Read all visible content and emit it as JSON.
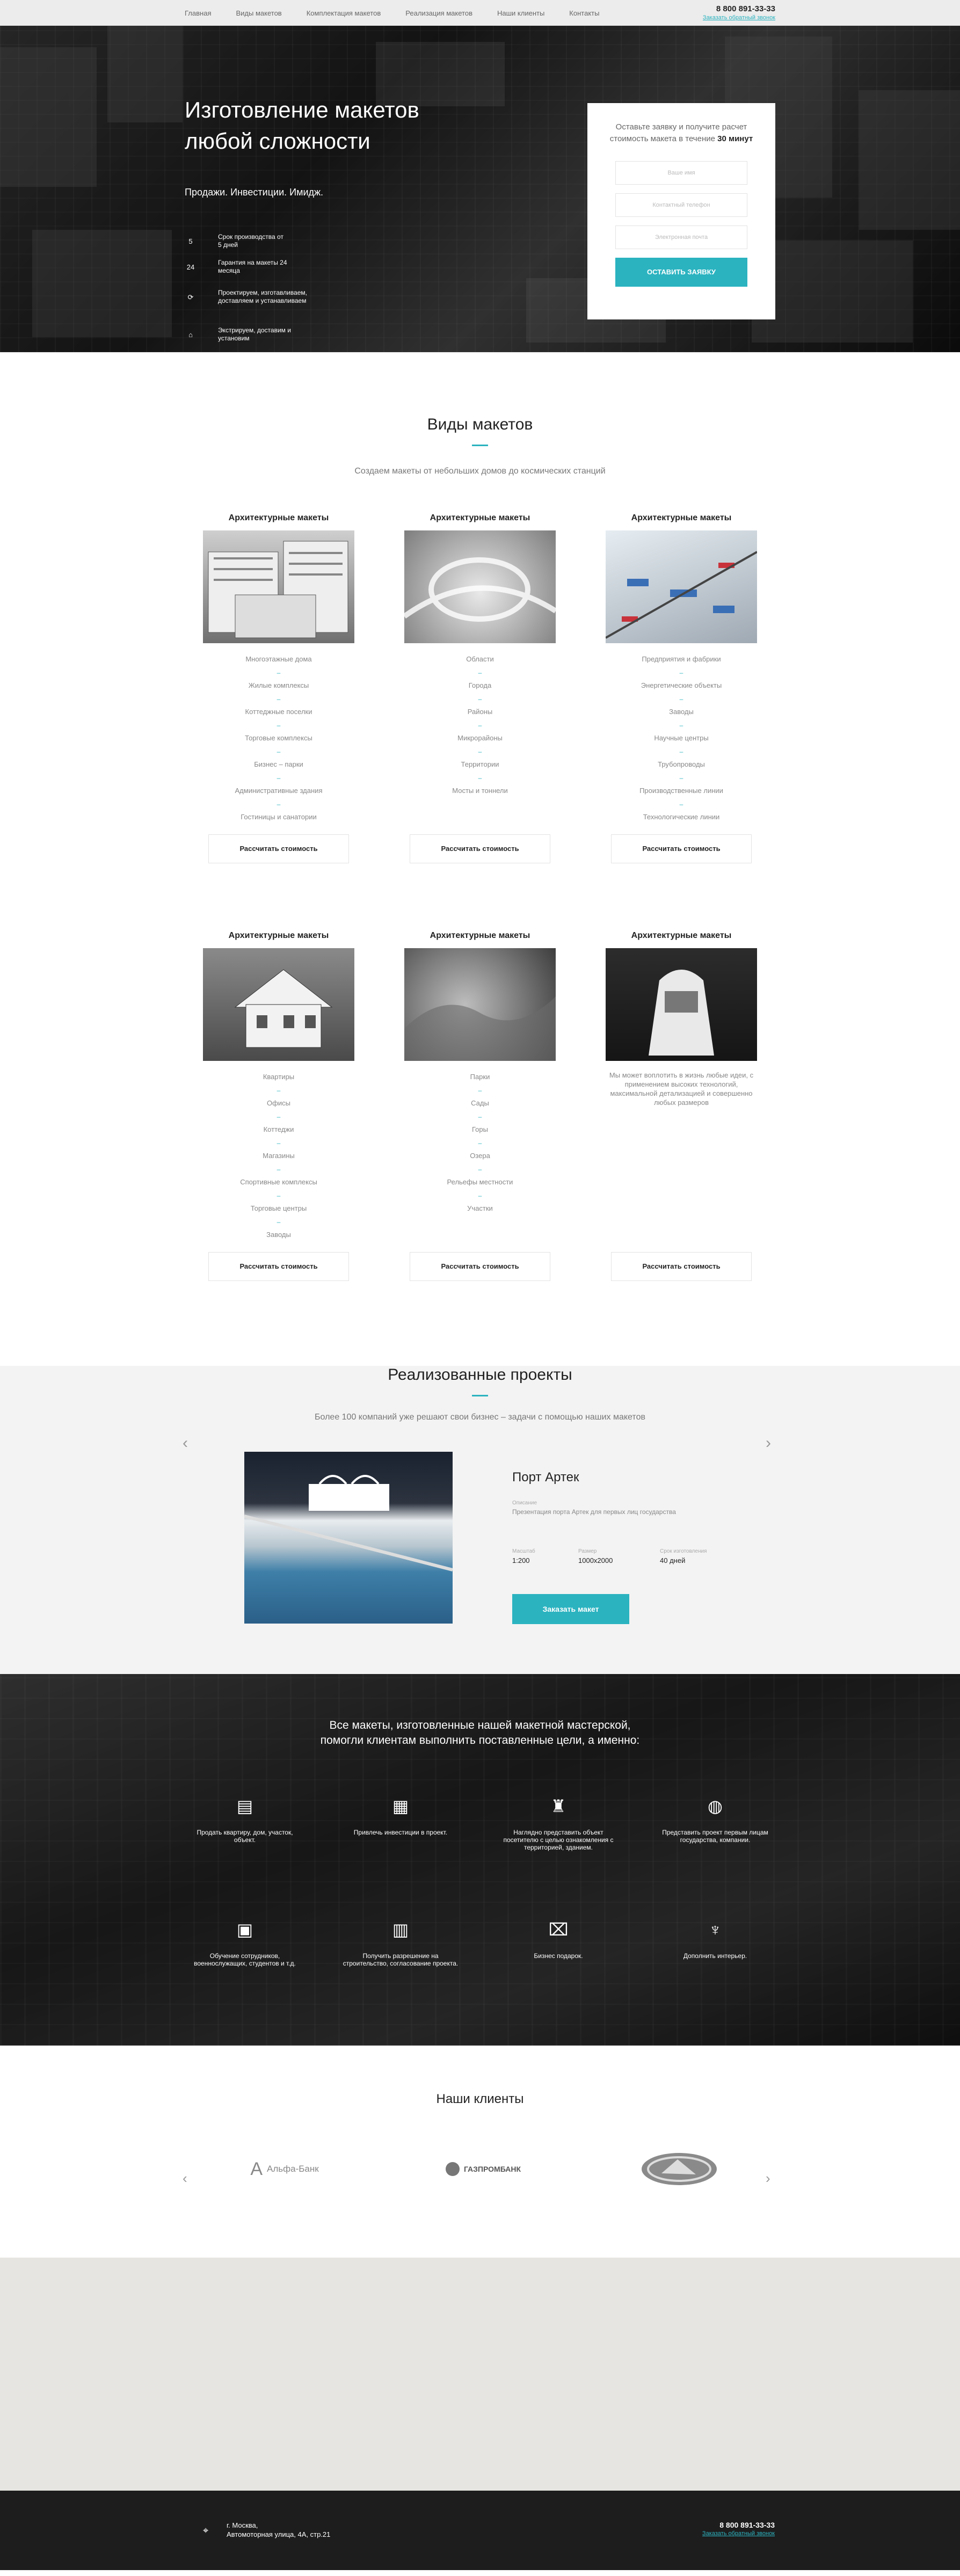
{
  "nav": {
    "links": [
      "Главная",
      "Виды макетов",
      "Комплектация макетов",
      "Реализация макетов",
      "Наши клиенты",
      "Контакты"
    ],
    "phone": "8 800 891-33-33",
    "callback": "Заказать обратный звонок"
  },
  "hero": {
    "title": "Изготовление макетов любой сложности",
    "subtitle": "Продажи. Инвестиции. Имидж.",
    "features": [
      {
        "icon": "5",
        "text": "Срок производства от 5 дней"
      },
      {
        "icon": "24",
        "text": "Гарантия на макеты 24 месяца"
      },
      {
        "icon": "cycle-icon",
        "text": "Проектируем, изготавливаем, доставляем и устанавливаем"
      },
      {
        "icon": "box-icon",
        "text": "Экстрируем, доставим и установим"
      }
    ],
    "form": {
      "text": "Оставьте заявку и получите расчет стоимость макета в течение",
      "bold": "30 минут",
      "name_placeholder": "Ваше имя",
      "phone_placeholder": "Контактный телефон",
      "email_placeholder": "Электронная почта",
      "button": "ОСТАВИТЬ ЗАЯВКУ"
    }
  },
  "types": {
    "title": "Виды макетов",
    "subtitle": "Создаем макеты от небольших домов до космических станций",
    "calc_label": "Рассчитать стоимость",
    "cards": [
      {
        "heading": "Архитектурные макеты",
        "items": [
          "Многоэтажные дома",
          "Жилые комплексы",
          "Коттеджные поселки",
          "Торговые комплексы",
          "Бизнес – парки",
          "Административные здания",
          "Гостиницы и санатории"
        ]
      },
      {
        "heading": "Архитектурные макеты",
        "items": [
          "Области",
          "Города",
          "Районы",
          "Микрорайоны",
          "Территории",
          "Мосты и тоннели"
        ]
      },
      {
        "heading": "Архитектурные макеты",
        "items": [
          "Предприятия и фабрики",
          "Энергетические объекты",
          "Заводы",
          "Научные центры",
          "Трубопроводы",
          "Производственные линии",
          "Технологические линии"
        ]
      },
      {
        "heading": "Архитектурные макеты",
        "items": [
          "Квартиры",
          "Офисы",
          "Коттеджи",
          "Магазины",
          "Спортивные комплексы",
          "Торговые центры",
          "Заводы"
        ]
      },
      {
        "heading": "Архитектурные макеты",
        "items": [
          "Парки",
          "Сады",
          "Горы",
          "Озера",
          "Рельефы местности",
          "Участки"
        ]
      },
      {
        "heading": "Архитектурные макеты",
        "description": "Мы может воплотить в жизнь любые идеи, с применением высоких технологий, максимальной детализацией и совершенно любых размеров"
      }
    ]
  },
  "projects": {
    "title": "Реализованные проекты",
    "subtitle": "Более 100 компаний уже решают свои бизнес – задачи с помощью наших макетов",
    "name": "Порт Артек",
    "desc_label": "Описание",
    "desc": "Презентация порта Артек для первых лиц государства",
    "scale_label": "Масштаб",
    "scale": "1:200",
    "size_label": "Размер",
    "size": "1000х2000",
    "term_label": "Срок изготовления",
    "term": "40 дней",
    "button": "Заказать макет"
  },
  "results": {
    "title_1": "Все макеты, изготовленные нашей макетной мастерской,",
    "title_2": "помогли клиентам выполнить поставленные цели, а именно:",
    "items": [
      {
        "icon": "sale-sign-icon",
        "text": "Продать квартиру, дом, участок, объект."
      },
      {
        "icon": "document-chart-icon",
        "text": "Привлечь инвестиции в проект."
      },
      {
        "icon": "city-icon",
        "text": "Наглядно представить объект посетителю с целью ознакомления с территорией, зданием."
      },
      {
        "icon": "globe-hand-icon",
        "text": "Представить проект первым лицам государства, компании."
      },
      {
        "icon": "presentation-icon",
        "text": "Обучение сотрудников, военнослужащих, студентов и т.д."
      },
      {
        "icon": "permit-document-icon",
        "text": "Получить разрешение на строительство, согласование проекта."
      },
      {
        "icon": "gift-icon",
        "text": "Бизнес подарок."
      },
      {
        "icon": "interior-icon",
        "text": "Дополнить интерьер."
      }
    ]
  },
  "clients": {
    "title": "Наши клиенты",
    "logos": [
      "Альфа-Банк",
      "ГАЗПРОМБАНК",
      "LADA"
    ]
  },
  "footer": {
    "city": "г. Москва,",
    "street": "Автомоторная улица, 4А, стр.21",
    "phone": "8 800 891-33-33",
    "callback": "Заказать обратный звонок"
  },
  "colors": {
    "accent": "#2bb3c0",
    "footer": "#1d1d1d",
    "projects_bg": "#f3f3f3"
  }
}
